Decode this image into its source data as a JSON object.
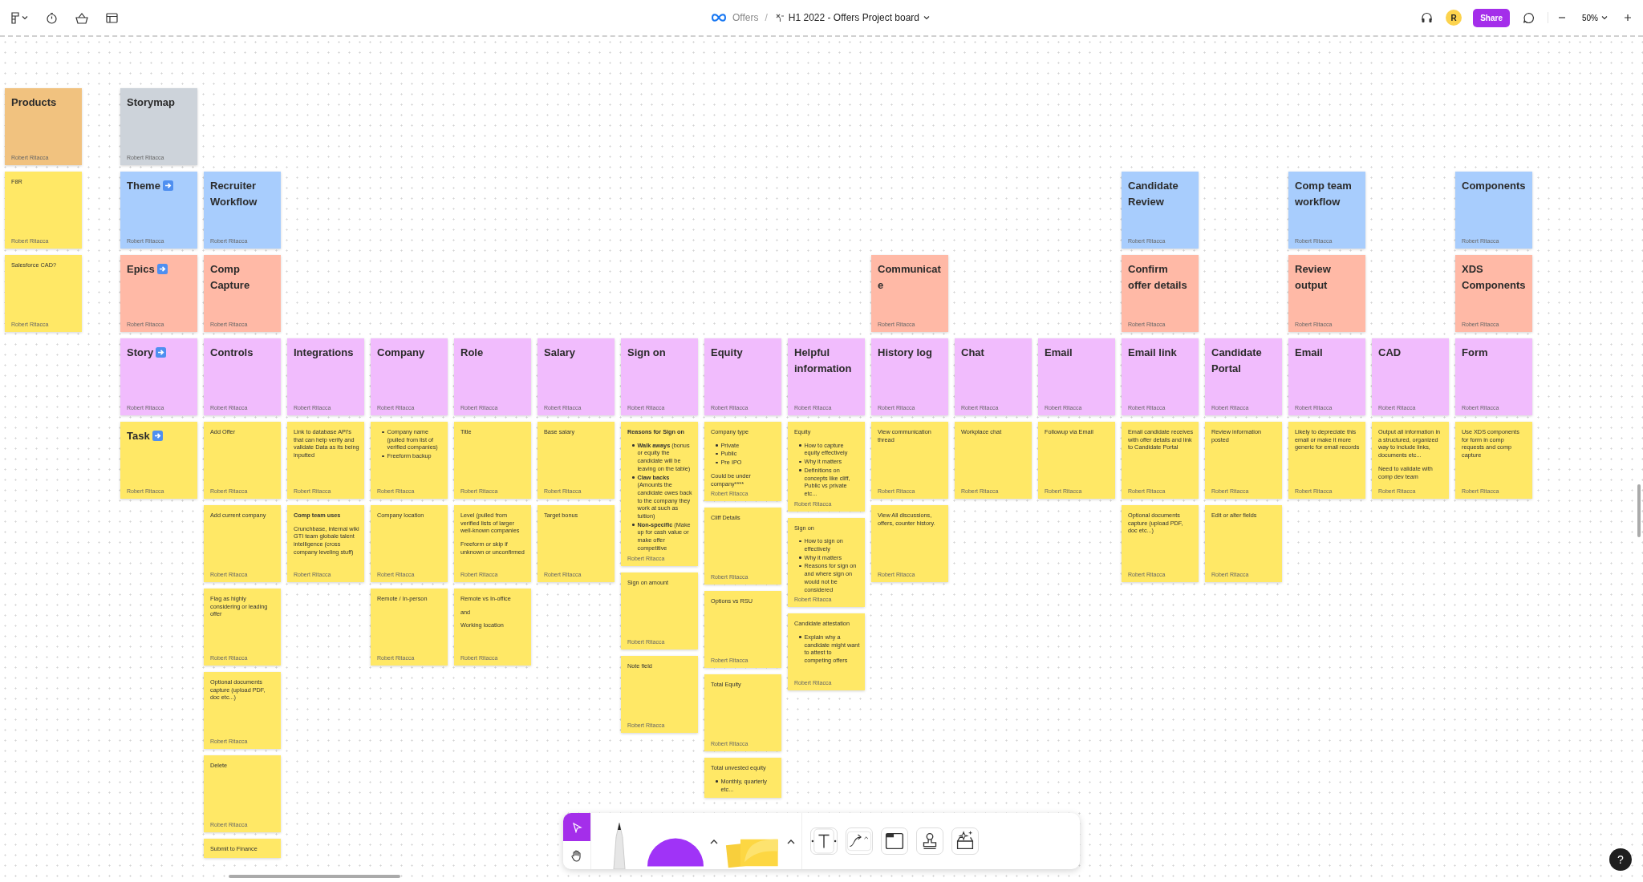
{
  "top_bar": {
    "project": "Offers",
    "separator": "/",
    "title": "H1 2022 - Offers Project board",
    "avatar": "R",
    "share": "Share",
    "zoom": "50%"
  },
  "side_stickies": [
    {
      "kind": "title",
      "text": "Products",
      "color": "#f1c27f",
      "author": "Robert Ritacca"
    },
    {
      "kind": "note",
      "blocks": [
        {
          "kind": "para",
          "text": "F8R"
        }
      ],
      "color": "#ffe866",
      "author": "Robert Ritacca"
    },
    {
      "kind": "note",
      "blocks": [
        {
          "kind": "para",
          "text": "Salesforce CAD?"
        }
      ],
      "color": "#ffe866",
      "author": "Robert Ritacca"
    }
  ],
  "columns": [
    {
      "storymap": {
        "kind": "title",
        "text": "Storymap",
        "color": "#cdd3da",
        "author": "Robert Ritacca"
      },
      "theme": {
        "kind": "title",
        "text": "Theme",
        "arrow": true,
        "color": "#a8cdfd",
        "author": "Robert Ritacca"
      },
      "epic": {
        "kind": "title",
        "text": "Epics",
        "arrow": true,
        "color": "#ffb9a6",
        "author": "Robert Ritacca"
      },
      "story": {
        "kind": "title",
        "text": "Story",
        "arrow": true,
        "color": "#f1bcfd",
        "author": "Robert Ritacca"
      },
      "tasks": [
        {
          "kind": "title",
          "text": "Task",
          "arrow": true,
          "color": "#ffe866",
          "author": "Robert Ritacca"
        }
      ]
    },
    {
      "theme": {
        "kind": "title",
        "text": "Recruiter Workflow",
        "color": "#a8cdfd",
        "author": "Robert Ritacca"
      },
      "epic": {
        "kind": "title",
        "text": "Comp Capture",
        "color": "#ffb9a6",
        "author": "Robert Ritacca"
      },
      "story": {
        "kind": "title",
        "text": "Controls",
        "color": "#f1bcfd",
        "author": "Robert Ritacca"
      },
      "tasks": [
        {
          "kind": "note",
          "blocks": [
            {
              "kind": "para",
              "text": "Add Offer"
            }
          ],
          "color": "#ffe866",
          "author": "Robert Ritacca"
        },
        {
          "kind": "note",
          "blocks": [
            {
              "kind": "para",
              "text": "Add current company"
            }
          ],
          "color": "#ffe866",
          "author": "Robert Ritacca"
        },
        {
          "kind": "note",
          "blocks": [
            {
              "kind": "para",
              "text": "Flag as highly considering or leading offer"
            }
          ],
          "color": "#ffe866",
          "author": "Robert Ritacca"
        },
        {
          "kind": "note",
          "blocks": [
            {
              "kind": "para",
              "text": "Optional documents capture (upload PDF, doc etc...)"
            }
          ],
          "color": "#ffe866",
          "author": "Robert Ritacca"
        },
        {
          "kind": "note",
          "blocks": [
            {
              "kind": "para",
              "text": "Delete"
            }
          ],
          "color": "#ffe866",
          "author": "Robert Ritacca"
        },
        {
          "kind": "note",
          "blocks": [
            {
              "kind": "para",
              "text": "Submit to Finance"
            }
          ],
          "color": "#ffe866"
        }
      ]
    },
    {
      "story": {
        "kind": "title",
        "text": "Integrations",
        "color": "#f1bcfd",
        "author": "Robert Ritacca"
      },
      "tasks": [
        {
          "kind": "note",
          "blocks": [
            {
              "kind": "para",
              "text": "Link to database API's that can help verify and validate Data as its being inputted"
            }
          ],
          "color": "#ffe866",
          "author": "Robert Ritacca"
        },
        {
          "kind": "note",
          "blocks": [
            {
              "kind": "bold",
              "text": "Comp team uses"
            },
            {
              "kind": "para",
              "text": "Crunchbase, internal wiki GTI team globale talent intelligence (cross company leveling stuff)"
            }
          ],
          "color": "#ffe866",
          "author": "Robert Ritacca"
        }
      ]
    },
    {
      "story": {
        "kind": "title",
        "text": "Company",
        "color": "#f1bcfd",
        "author": "Robert Ritacca"
      },
      "tasks": [
        {
          "kind": "note",
          "blocks": [
            {
              "kind": "bullets",
              "items": [
                "Company name (pulled from list of verified companies)",
                "Freeform backup"
              ]
            }
          ],
          "color": "#ffe866",
          "author": "Robert Ritacca"
        },
        {
          "kind": "note",
          "blocks": [
            {
              "kind": "para",
              "text": "Company location"
            }
          ],
          "color": "#ffe866",
          "author": "Robert Ritacca"
        },
        {
          "kind": "note",
          "blocks": [
            {
              "kind": "para",
              "text": "Remote / In-person"
            }
          ],
          "color": "#ffe866",
          "author": "Robert Ritacca"
        }
      ]
    },
    {
      "story": {
        "kind": "title",
        "text": "Role",
        "color": "#f1bcfd",
        "author": "Robert Ritacca"
      },
      "tasks": [
        {
          "kind": "note",
          "blocks": [
            {
              "kind": "para",
              "text": "Title"
            }
          ],
          "color": "#ffe866",
          "author": "Robert Ritacca"
        },
        {
          "kind": "note",
          "blocks": [
            {
              "kind": "para",
              "text": "Level (pulled from verified lists of larger well-known companies"
            },
            {
              "kind": "para",
              "text": "Freeform or skip if unknown or unconfirmed"
            }
          ],
          "color": "#ffe866",
          "author": "Robert Ritacca"
        },
        {
          "kind": "note",
          "blocks": [
            {
              "kind": "para",
              "text": "Remote vs In-office"
            },
            {
              "kind": "para",
              "text": "and"
            },
            {
              "kind": "para",
              "text": "Working location"
            }
          ],
          "color": "#ffe866",
          "author": "Robert Ritacca"
        }
      ]
    },
    {
      "story": {
        "kind": "title",
        "text": "Salary",
        "color": "#f1bcfd",
        "author": "Robert Ritacca"
      },
      "tasks": [
        {
          "kind": "note",
          "blocks": [
            {
              "kind": "para",
              "text": "Base salary"
            }
          ],
          "color": "#ffe866",
          "author": "Robert Ritacca"
        },
        {
          "kind": "note",
          "blocks": [
            {
              "kind": "para",
              "text": "Target bonus"
            }
          ],
          "color": "#ffe866",
          "author": "Robert Ritacca"
        }
      ]
    },
    {
      "story": {
        "kind": "title",
        "text": "Sign on",
        "color": "#f1bcfd",
        "author": "Robert Ritacca"
      },
      "tasks": [
        {
          "kind": "note",
          "blocks": [
            {
              "kind": "bold",
              "text": "Reasons for Sign on"
            },
            {
              "kind": "bullets",
              "items": [
                "**Walk aways** (bonus or equity the candidate will be leaving on the table)",
                "**Claw backs** (Amounts the candidate owes back to the company they work at such as tuition)",
                "**Non-specific** (Make up for cash value or make offer competitive"
              ]
            }
          ],
          "color": "#ffe866",
          "author": "Robert Ritacca"
        },
        {
          "kind": "note",
          "blocks": [
            {
              "kind": "para",
              "text": "Sign on amount"
            }
          ],
          "color": "#ffe866",
          "author": "Robert Ritacca"
        },
        {
          "kind": "note",
          "blocks": [
            {
              "kind": "para",
              "text": "Note field"
            }
          ],
          "color": "#ffe866",
          "author": "Robert Ritacca"
        }
      ]
    },
    {
      "story": {
        "kind": "title",
        "text": "Equity",
        "color": "#f1bcfd",
        "author": "Robert Ritacca"
      },
      "tasks": [
        {
          "kind": "note",
          "blocks": [
            {
              "kind": "para",
              "text": "Company type"
            },
            {
              "kind": "bullets",
              "items": [
                "Private",
                "Public",
                "Pre IPO"
              ]
            },
            {
              "kind": "para",
              "text": "Could be under company****"
            }
          ],
          "color": "#ffe866",
          "author": "Robert Ritacca"
        },
        {
          "kind": "note",
          "blocks": [
            {
              "kind": "para",
              "text": "Cliff Details"
            }
          ],
          "color": "#ffe866",
          "author": "Robert Ritacca"
        },
        {
          "kind": "note",
          "blocks": [
            {
              "kind": "para",
              "text": "Options vs RSU"
            }
          ],
          "color": "#ffe866",
          "author": "Robert Ritacca"
        },
        {
          "kind": "note",
          "blocks": [
            {
              "kind": "para",
              "text": "Total Equity"
            }
          ],
          "color": "#ffe866",
          "author": "Robert Ritacca"
        },
        {
          "kind": "note",
          "blocks": [
            {
              "kind": "para",
              "text": "Total unvested equity"
            },
            {
              "kind": "bullets",
              "items": [
                "Monthly, quarterly etc..."
              ]
            }
          ],
          "color": "#ffe866"
        }
      ]
    },
    {
      "story": {
        "kind": "title",
        "text": "Helpful information",
        "color": "#f1bcfd",
        "author": "Robert Ritacca"
      },
      "tasks": [
        {
          "kind": "note",
          "blocks": [
            {
              "kind": "para",
              "text": "Equity"
            },
            {
              "kind": "bullets",
              "items": [
                "How to capture equity effectively",
                "Why it matters",
                "Definitions on concepts like cliff, Public vs private etc..."
              ]
            }
          ],
          "color": "#ffe866",
          "author": "Robert Ritacca"
        },
        {
          "kind": "note",
          "blocks": [
            {
              "kind": "para",
              "text": "Sign on"
            },
            {
              "kind": "bullets",
              "items": [
                "How to sign on effectively",
                "Why it matters",
                "Reasons for sign on and where sign on would not be considered"
              ]
            }
          ],
          "color": "#ffe866",
          "author": "Robert Ritacca"
        },
        {
          "kind": "note",
          "blocks": [
            {
              "kind": "para",
              "text": "Candidate attestation"
            },
            {
              "kind": "bullets",
              "items": [
                "Explain why a candidate might want to attest to competing offers"
              ]
            }
          ],
          "color": "#ffe866",
          "author": "Robert Ritacca"
        }
      ]
    },
    {
      "epic": {
        "kind": "title",
        "text": "Communicate",
        "color": "#ffb9a6",
        "author": "Robert Ritacca"
      },
      "story": {
        "kind": "title",
        "text": "History log",
        "color": "#f1bcfd",
        "author": "Robert Ritacca"
      },
      "tasks": [
        {
          "kind": "note",
          "blocks": [
            {
              "kind": "para",
              "text": "View communication thread"
            }
          ],
          "color": "#ffe866",
          "author": "Robert Ritacca"
        },
        {
          "kind": "note",
          "blocks": [
            {
              "kind": "para",
              "text": "View All discussions, offers, counter history."
            }
          ],
          "color": "#ffe866",
          "author": "Robert Ritacca"
        }
      ]
    },
    {
      "story": {
        "kind": "title",
        "text": "Chat",
        "color": "#f1bcfd",
        "author": "Robert Ritacca"
      },
      "tasks": [
        {
          "kind": "note",
          "blocks": [
            {
              "kind": "para",
              "text": "Workplace chat"
            }
          ],
          "color": "#ffe866",
          "author": "Robert Ritacca"
        }
      ]
    },
    {
      "story": {
        "kind": "title",
        "text": "Email",
        "color": "#f1bcfd",
        "author": "Robert Ritacca"
      },
      "tasks": [
        {
          "kind": "note",
          "blocks": [
            {
              "kind": "para",
              "text": "Followup via Email"
            }
          ],
          "color": "#ffe866",
          "author": "Robert Ritacca"
        }
      ]
    },
    {
      "theme": {
        "kind": "title",
        "text": "Candidate Review",
        "color": "#a8cdfd",
        "author": "Robert Ritacca"
      },
      "epic": {
        "kind": "title",
        "text": "Confirm offer details",
        "color": "#ffb9a6",
        "author": "Robert Ritacca"
      },
      "story": {
        "kind": "title",
        "text": "Email link",
        "color": "#f1bcfd",
        "author": "Robert Ritacca"
      },
      "tasks": [
        {
          "kind": "note",
          "blocks": [
            {
              "kind": "para",
              "text": "Email candidate receives with offer details and link to Candidate Portal"
            }
          ],
          "color": "#ffe866",
          "author": "Robert Ritacca"
        },
        {
          "kind": "note",
          "blocks": [
            {
              "kind": "para",
              "text": "Optional documents capture (upload PDF, doc etc...)"
            }
          ],
          "color": "#ffe866",
          "author": "Robert Ritacca"
        }
      ]
    },
    {
      "story": {
        "kind": "title",
        "text": "Candidate Portal",
        "color": "#f1bcfd",
        "author": "Robert Ritacca"
      },
      "tasks": [
        {
          "kind": "note",
          "blocks": [
            {
              "kind": "para",
              "text": "Review information posted"
            }
          ],
          "color": "#ffe866",
          "author": "Robert Ritacca"
        },
        {
          "kind": "note",
          "blocks": [
            {
              "kind": "para",
              "text": "Edit or alter fields"
            }
          ],
          "color": "#ffe866",
          "author": "Robert Ritacca"
        }
      ]
    },
    {
      "theme": {
        "kind": "title",
        "text": "Comp team workflow",
        "color": "#a8cdfd",
        "author": "Robert Ritacca"
      },
      "epic": {
        "kind": "title",
        "text": "Review output",
        "color": "#ffb9a6",
        "author": "Robert Ritacca"
      },
      "story": {
        "kind": "title",
        "text": "Email",
        "color": "#f1bcfd",
        "author": "Robert Ritacca"
      },
      "tasks": [
        {
          "kind": "note",
          "blocks": [
            {
              "kind": "para",
              "text": "Likely to depreciate this email or make it more generic for email records"
            }
          ],
          "color": "#ffe866",
          "author": "Robert Ritacca"
        }
      ]
    },
    {
      "story": {
        "kind": "title",
        "text": "CAD",
        "color": "#f1bcfd",
        "author": "Robert Ritacca"
      },
      "tasks": [
        {
          "kind": "note",
          "blocks": [
            {
              "kind": "para",
              "text": "Output all information in a structured, organized way to include links, documents etc..."
            },
            {
              "kind": "para",
              "text": "Need to validate with comp dev team"
            }
          ],
          "color": "#ffe866",
          "author": "Robert Ritacca"
        }
      ]
    },
    {
      "theme": {
        "kind": "title",
        "text": "Components",
        "color": "#a8cdfd",
        "author": "Robert Ritacca"
      },
      "epic": {
        "kind": "title",
        "text": "XDS Components",
        "color": "#ffb9a6",
        "author": "Robert Ritacca"
      },
      "story": {
        "kind": "title",
        "text": "Form",
        "color": "#f1bcfd",
        "author": "Robert Ritacca"
      },
      "tasks": [
        {
          "kind": "note",
          "blocks": [
            {
              "kind": "para",
              "text": "Use XDS components for form in comp requests and comp capture"
            }
          ],
          "color": "#ffe866",
          "author": "Robert Ritacca"
        }
      ]
    }
  ],
  "tools": [
    {
      "kind": "select",
      "selected": true
    },
    {
      "kind": "hand",
      "selected": false
    },
    {
      "kind": "pen",
      "selected": false
    },
    {
      "kind": "shape",
      "selected": false
    },
    {
      "kind": "sticky",
      "selected": false
    },
    {
      "kind": "text",
      "selected": false
    },
    {
      "kind": "connector",
      "selected": false
    },
    {
      "kind": "section",
      "selected": false
    },
    {
      "kind": "stamp",
      "selected": false
    },
    {
      "kind": "widget",
      "selected": false
    }
  ],
  "help": "?"
}
